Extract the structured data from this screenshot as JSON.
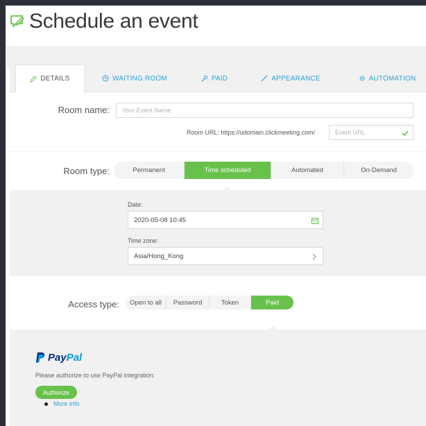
{
  "header": {
    "title": "Schedule an event"
  },
  "tabs": [
    {
      "label": "DETAILS",
      "icon": "pencil-icon"
    },
    {
      "label": "WAITING ROOM",
      "icon": "clock-icon"
    },
    {
      "label": "PAID",
      "icon": "key-icon"
    },
    {
      "label": "APPEARANCE",
      "icon": "brush-icon"
    },
    {
      "label": "AUTOMATION",
      "icon": "gear-icon"
    }
  ],
  "room": {
    "name_label": "Room name:",
    "name_placeholder": "Your Event Name",
    "url_label": "Room URL: https://udomain.clickmeeting.com/",
    "url_placeholder": "Event URL"
  },
  "room_type": {
    "label": "Room type:",
    "options": [
      "Permanent",
      "Time scheduled",
      "Automated",
      "On-Demand"
    ],
    "selected": "Time scheduled"
  },
  "schedule": {
    "date_label": "Date:",
    "date_value": "2020-05-08 10:45",
    "timezone_label": "Time zone:",
    "timezone_value": "Asia/Hong_Kong"
  },
  "access_type": {
    "label": "Access type:",
    "options": [
      "Open to all",
      "Password",
      "Token",
      "Paid"
    ],
    "selected": "Paid"
  },
  "paypal": {
    "brand_pay": "Pay",
    "brand_pal": "Pal",
    "message": "Please authorize to use PayPal integration:",
    "authorize_label": "Authorize",
    "more_info": "More info"
  },
  "colors": {
    "accent_green": "#68c14b",
    "link_blue": "#2ba3d6",
    "paypal_dark": "#003087",
    "paypal_light": "#009cde"
  }
}
